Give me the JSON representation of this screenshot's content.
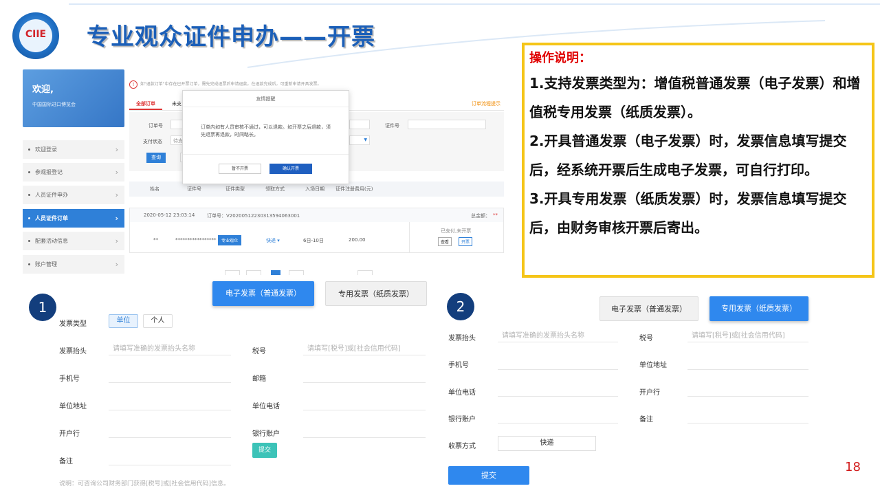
{
  "header": {
    "logo_text": "CIIE",
    "title": "专业观众证件申办——开票"
  },
  "sidebar": {
    "welcome": "欢迎,",
    "org": "中国国际进口博览会",
    "items": [
      {
        "label": "欢迎登录"
      },
      {
        "label": "参观报登记"
      },
      {
        "label": "人员证件申办"
      },
      {
        "label": "人员证件订单"
      },
      {
        "label": "配套活动信息"
      },
      {
        "label": "账户管理"
      }
    ]
  },
  "list": {
    "notice": "如\"退款订单\"中存在已开票订单，需先完成退票后申请退款。在退款完成后，可重新申请开具发票。",
    "tabs": [
      "全部订单",
      "未支"
    ],
    "process_tip": "订单流程提示",
    "filters": {
      "order_no": "订单号",
      "cert_no": "证件号",
      "pay_status": "支付状态",
      "pay_status_value": "待支",
      "query_btn": "查询"
    },
    "columns": [
      "姓名",
      "证件号",
      "证件类型",
      "领取方式",
      "入场日期",
      "证件注册费用(元)"
    ],
    "order": {
      "time": "2020-05-12 23:03:14",
      "order_no": "订单号：V2020051223031359406300​1",
      "total": "总金额：",
      "total_value": "**",
      "name": "**",
      "cert": "*****************",
      "cert_type": "专业观众",
      "delivery": "快递",
      "date": "6日-10日",
      "fee": "200.00",
      "status": "已支付,未开票",
      "view_btn": "查看",
      "invoice_btn": "开票"
    }
  },
  "popup": {
    "title": "友情提醒",
    "text": "订单内如有人员审核不通过，可以退款。如开票之后退款，须先退票再退款，时间略长。",
    "cancel": "暂不开票",
    "confirm": "确认开票"
  },
  "instructions": {
    "title": "操作说明：",
    "p1": "1.支持发票类型为：增值税普通发票（电子发票）和增值税专用发票（纸质发票）。",
    "p2": "2.开具普通发票（电子发票）时，发票信息填写提交后，经系统开票后生成电子发票，可自行打印。",
    "p3": "3.开具专用发票（纸质发票）时，发票信息填写提交后，由财务审核开票后寄出。"
  },
  "form1": {
    "step": "1",
    "tab_electronic": "电子发票（普通发票）",
    "tab_special": "专用发票（纸质发票）",
    "invoice_type": "发票类型",
    "opt_unit": "单位",
    "opt_personal": "个人",
    "title_label": "发票抬头",
    "title_ph": "请填写准确的发票抬头名称",
    "tax_label": "税号",
    "tax_ph": "请填写[税号]或[社会信用代码]",
    "phone": "手机号",
    "email": "邮箱",
    "address": "单位地址",
    "unit_phone": "单位电话",
    "bank": "开户行",
    "account": "银行账户",
    "remark": "备注",
    "submit": "提交",
    "note": "说明：可咨询公司财务部门获得[税号]或[社会信用代码]信息。"
  },
  "form2": {
    "step": "2",
    "tab_electronic": "电子发票（普通发票）",
    "tab_special": "专用发票（纸质发票）",
    "title_label": "发票抬头",
    "title_ph": "请填写准确的发票抬头名称",
    "tax_label": "税号",
    "tax_ph": "请填写[税号]或[社会信用代码]",
    "phone": "手机号",
    "address": "单位地址",
    "unit_phone": "单位电话",
    "bank": "开户行",
    "account": "银行账户",
    "remark": "备注",
    "receive": "收票方式",
    "receive_value": "快递",
    "submit": "提交"
  },
  "page_number": "18",
  "colors": {
    "brand_blue": "#2f88ee",
    "title_blue": "#1b5fb8",
    "accent_red": "#d33333",
    "border_yellow": "#f5c518"
  }
}
